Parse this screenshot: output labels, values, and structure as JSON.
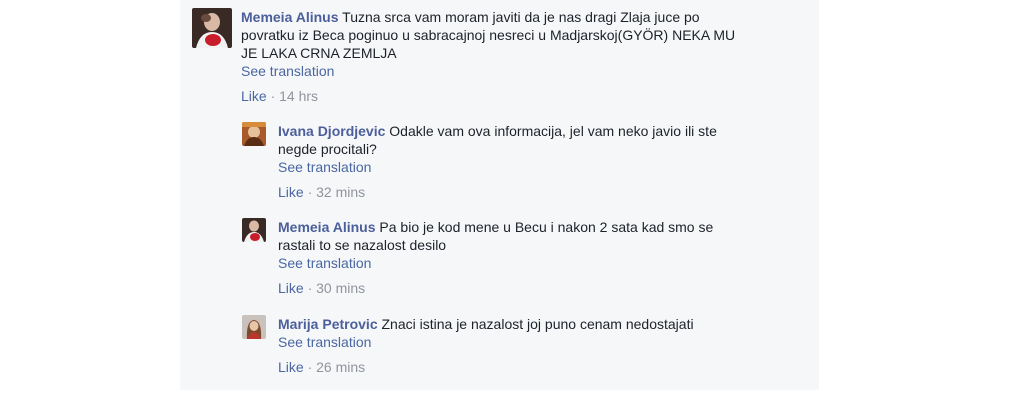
{
  "comments": [
    {
      "author": "Memeia Alinus",
      "text": "Tuzna srca vam moram javiti da je nas dragi Zlaja juce po povratku iz Beca poginuo u sabracajnoj nesreci u Madjarskoj(GYÖR) NEKA MU JE LAKA CRNA ZEMLJA",
      "lines": [
        "Tuzna srca vam moram javiti da je nas dragi Zlaja juce po",
        "povratku iz Beca poginuo u sabracajnoj nesreci u Madjarskoj(GYÖR) NEKA MU",
        "JE LAKA CRNA ZEMLJA"
      ],
      "see_translation": "See translation",
      "like": "Like",
      "separator": "·",
      "time": "14 hrs",
      "avatar_icon": "profile-photo-icon"
    },
    {
      "author": "Ivana Djordjevic",
      "lines": [
        "Odakle vam ova informacija, jel vam neko javio ili ste",
        "negde procitali?"
      ],
      "see_translation": "See translation",
      "like": "Like",
      "separator": "·",
      "time": "32 mins",
      "avatar_icon": "profile-photo-icon"
    },
    {
      "author": "Memeia Alinus",
      "lines": [
        "Pa bio je kod mene u Becu i nakon 2 sata kad smo se",
        "rastali to se nazalost desilo"
      ],
      "see_translation": "See translation",
      "like": "Like",
      "separator": "·",
      "time": "30 mins",
      "avatar_icon": "profile-photo-icon"
    },
    {
      "author": "Marija Petrovic",
      "lines": [
        "Znaci istina je nazalost joj puno cenam nedostajati"
      ],
      "see_translation": "See translation",
      "like": "Like",
      "separator": "·",
      "time": "26 mins",
      "avatar_icon": "profile-photo-icon"
    }
  ],
  "colors": {
    "author": "#4b5f9a",
    "link": "#4b67a1",
    "meta": "#90949c",
    "panel": "#f6f7f9"
  }
}
